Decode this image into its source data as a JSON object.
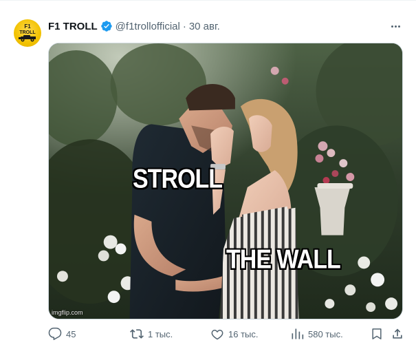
{
  "tweet": {
    "author_name": "F1 TROLL",
    "handle": "@f1trollofficial",
    "separator": "·",
    "date": "30 авг.",
    "avatar_text_top": "F1",
    "avatar_text_bottom": "TROLL",
    "verified": true
  },
  "media": {
    "label_top": "STROLL",
    "label_bottom": "THE WALL",
    "watermark": "imgflip.com"
  },
  "actions": {
    "replies": "45",
    "retweets": "1 тыс.",
    "likes": "16 тыс.",
    "views": "580 тыс."
  },
  "colors": {
    "text_primary": "#0f1419",
    "text_secondary": "#536471",
    "verified_blue": "#1d9bf0",
    "avatar_yellow": "#f2c200"
  },
  "icons": {
    "avatar": "f1-troll-logo",
    "verified": "verified-badge-icon",
    "more": "more-icon",
    "reply": "reply-icon",
    "retweet": "retweet-icon",
    "like": "like-icon",
    "views": "views-icon",
    "bookmark": "bookmark-icon",
    "share": "share-icon"
  }
}
